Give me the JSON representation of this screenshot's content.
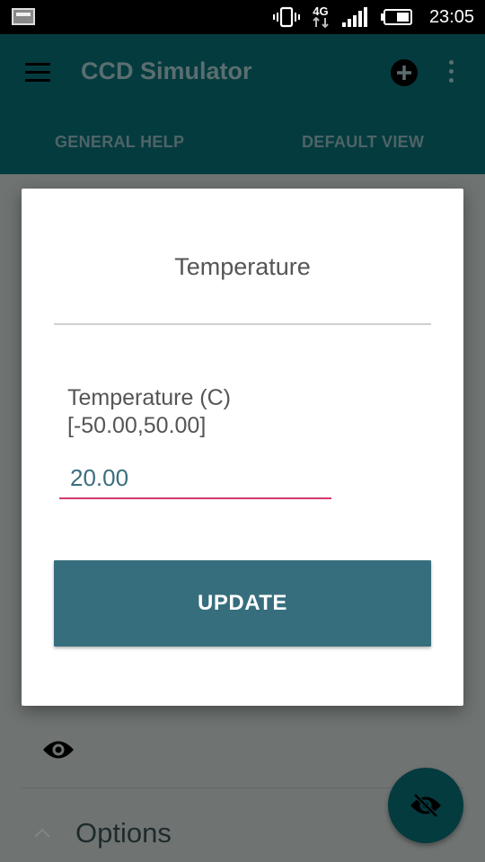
{
  "status_bar": {
    "network": "4G",
    "time": "23:05"
  },
  "app_bar": {
    "title": "CCD Simulator",
    "tabs": [
      "GENERAL HELP",
      "DEFAULT VIEW"
    ]
  },
  "dialog": {
    "title": "Temperature",
    "field_label_line1": "Temperature (C)",
    "field_label_line2": "[-50.00,50.00]",
    "field_value": "20.00",
    "button_label": "UPDATE"
  },
  "background": {
    "section_label": "Options"
  },
  "colors": {
    "app_bar": "#043b3f",
    "accent_button": "#366e7d",
    "input_underline": "#d43a70",
    "scrim_bg": "#6f7372"
  }
}
